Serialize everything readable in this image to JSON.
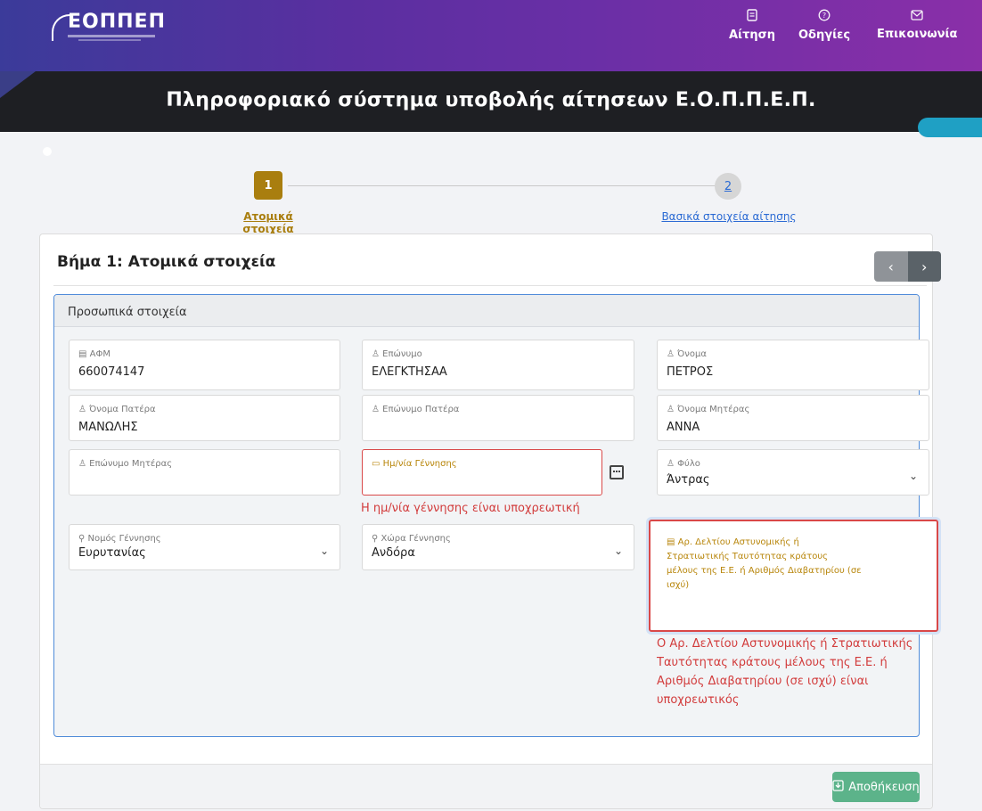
{
  "header": {
    "logo_text": "ΕΟΠΠΕΠ",
    "nav": [
      {
        "icon": "📄",
        "label": "Αίτηση"
      },
      {
        "icon": "⓪",
        "label": "Οδηγίες"
      },
      {
        "icon": "✉",
        "label": "Επικοινωνία"
      }
    ]
  },
  "banner": {
    "title": "Πληροφοριακό σύστημα υποβολής αίτησεων Ε.Ο.Π.Π.Ε.Π."
  },
  "stepper": {
    "step1": {
      "number": "1",
      "label": "Ατομικά στοιχεία"
    },
    "step2": {
      "number": "2",
      "label": "Βασικά στοιχεία αίτησης"
    }
  },
  "card": {
    "title": "Βήμα 1: Ατομικά στοιχεία",
    "prev": "‹",
    "next": "›",
    "panel_title": "Προσωπικά στοιχεία"
  },
  "fields": {
    "afm": {
      "label": "ΑΦΜ",
      "value": "660074147"
    },
    "surname": {
      "label": "Επώνυμο",
      "value": "ΕΛΕΓΚΤΗΣΑΑ"
    },
    "name": {
      "label": "Όνομα",
      "value": "ΠΕΤΡΟΣ"
    },
    "father_name": {
      "label": "Όνομα Πατέρα",
      "value": "ΜΑΝΩΛΗΣ"
    },
    "father_surname": {
      "label": "Επώνυμο Πατέρα",
      "value": ""
    },
    "mother_name": {
      "label": "Όνομα Μητέρας",
      "value": "ΑΝΝΑ"
    },
    "mother_surname": {
      "label": "Επώνυμο Μητέρας",
      "value": ""
    },
    "birth_date": {
      "label": "Ημ/νία Γέννησης",
      "value": "",
      "error": "Η ημ/νία γέννησης είναι υποχρεωτική"
    },
    "gender": {
      "label": "Φύλο",
      "value": "Άντρας"
    },
    "birth_prefecture": {
      "label": "Νομός Γέννησης",
      "value": "Ευρυτανίας"
    },
    "birth_country": {
      "label": "Χώρα Γέννησης",
      "value": "Ανδόρα"
    },
    "id_number": {
      "label_lines": [
        "Αρ. Δελτίου Αστυνομικής ή",
        "Στρατιωτικής Ταυτότητας κράτους",
        "μέλους της Ε.Ε. ή Αριθμός Διαβατηρίου (σε",
        "ισχύ)"
      ],
      "error_lines": [
        "Ο Αρ. Δελτίου Αστυνομικής ή Στρατιωτικής",
        "Ταυτότητας κράτους μέλους της Ε.Ε. ή",
        "Αριθμός Διαβατηρίου (σε ισχύ) είναι",
        "υποχρεωτικός"
      ]
    }
  },
  "footer": {
    "save_label": "Αποθήκευση"
  }
}
